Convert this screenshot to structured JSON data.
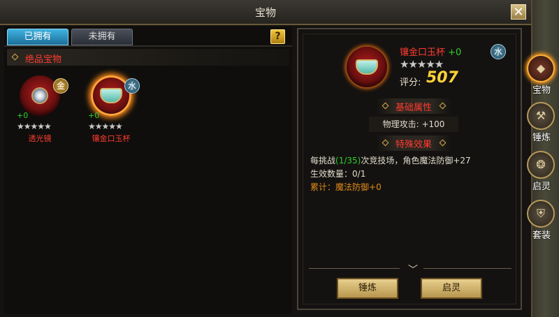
{
  "window": {
    "title": "宝物",
    "close_label": "✕"
  },
  "tabs": [
    {
      "label": "已拥有",
      "active": true
    },
    {
      "label": "未拥有",
      "active": false
    }
  ],
  "help_label": "?",
  "section": {
    "label": "绝品宝物"
  },
  "treasures": [
    {
      "name": "透光镜",
      "plus": "+0",
      "stars": "★★★★★",
      "element": "金",
      "icon": "mirror-icon"
    },
    {
      "name": "镶金口玉杯",
      "plus": "+0",
      "stars": "★★★★★",
      "element": "水",
      "icon": "cup-icon",
      "selected": true
    }
  ],
  "detail": {
    "name": "镶金口玉杯",
    "plus": "+0",
    "element": "水",
    "stars": "★★★★★",
    "score_label": "评分:",
    "score": "507",
    "basic_header": "基础属性",
    "attr_label": "物理攻击:",
    "attr_value": "+100",
    "special_header": "特殊效果",
    "effect_prefix": "每挑战",
    "effect_count": "(1/35)",
    "effect_suffix": "次竞技场，角色魔法防御+27",
    "stack_label": "生效数量：",
    "stack_value": "0/1",
    "cumulative_label": "累计：",
    "cumulative_value": "魔法防御+0",
    "expand_icon": "chevron-down-icon",
    "forge_button": "锤炼",
    "awaken_button": "启灵"
  },
  "side_nav": [
    {
      "label": "宝物",
      "icon": "treasure-icon",
      "active": true
    },
    {
      "label": "锤炼",
      "icon": "forge-icon",
      "active": false
    },
    {
      "label": "启灵",
      "icon": "awaken-icon",
      "active": false
    },
    {
      "label": "套装",
      "icon": "armor-set-icon",
      "active": false
    }
  ],
  "colors": {
    "rarity_red": "#ff3b30",
    "plus_green": "#2fd02f",
    "score_gold": "#ffd23a",
    "tab_blue": "#3fb3e0",
    "button_gold": "#e8cf8e"
  }
}
